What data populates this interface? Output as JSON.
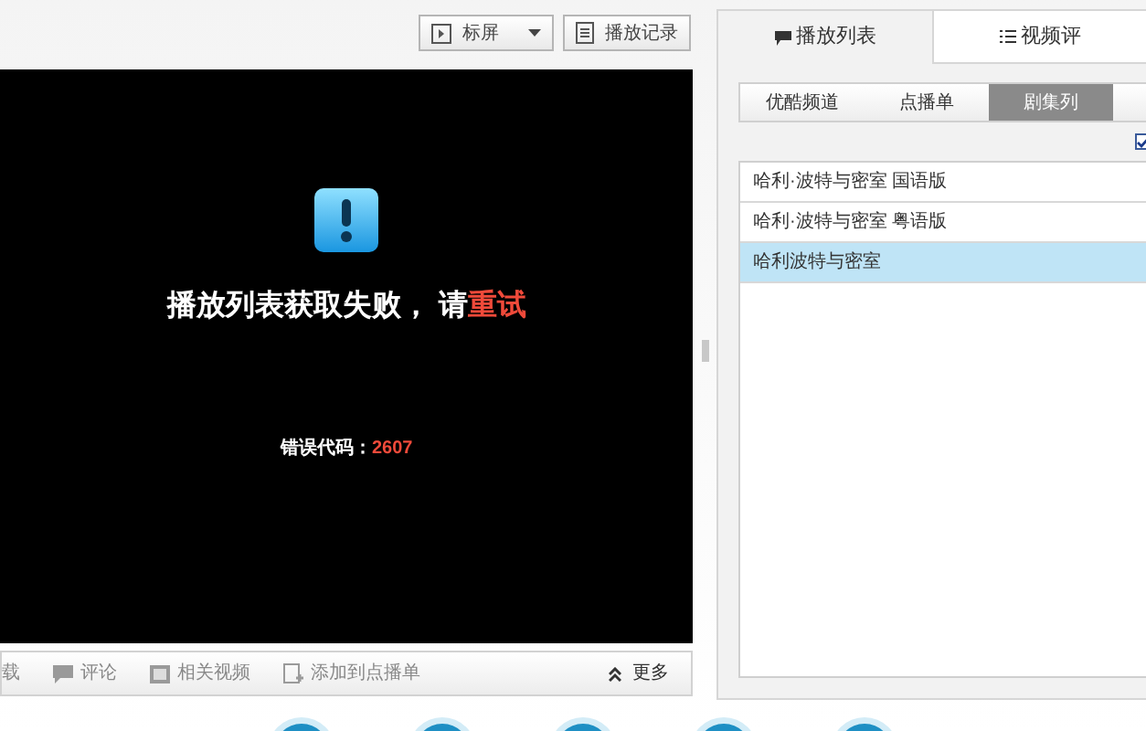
{
  "toolbar": {
    "buttons": [
      {
        "kind": "screen",
        "label": "标屏"
      },
      {
        "kind": "history",
        "label": "播放记录"
      }
    ]
  },
  "player": {
    "message": "播放列表获取失败， 请",
    "retry": "重试",
    "error_label": "错误代码：",
    "error_code": "2607"
  },
  "bottom_bar": {
    "actions": [
      {
        "kind": "plain",
        "label": "载"
      },
      {
        "kind": "comment",
        "label": "评论"
      },
      {
        "kind": "related",
        "label": "相关视频"
      },
      {
        "kind": "add",
        "label": "添加到点播单"
      }
    ],
    "more": "更多"
  },
  "side_tabs": [
    {
      "label": "播放列表",
      "kind": "comment",
      "selected": true
    },
    {
      "label": "视频评",
      "kind": "list",
      "selected": false
    }
  ],
  "sub_tabs": [
    {
      "label": "优酷频道",
      "selected": false
    },
    {
      "label": "点播单",
      "selected": false
    },
    {
      "label": "剧集列",
      "selected": true
    }
  ],
  "filter": {
    "checked": true
  },
  "episodes": [
    {
      "title": "哈利·波特与密室 国语版",
      "selected": false
    },
    {
      "title": "哈利·波特与密室 粤语版",
      "selected": false
    },
    {
      "title": "哈利波特与密室",
      "selected": true
    }
  ],
  "dock_buttons": [
    {
      "kind": "round"
    },
    {
      "kind": "round"
    },
    {
      "kind": "round"
    },
    {
      "kind": "round"
    },
    {
      "kind": "round"
    }
  ]
}
